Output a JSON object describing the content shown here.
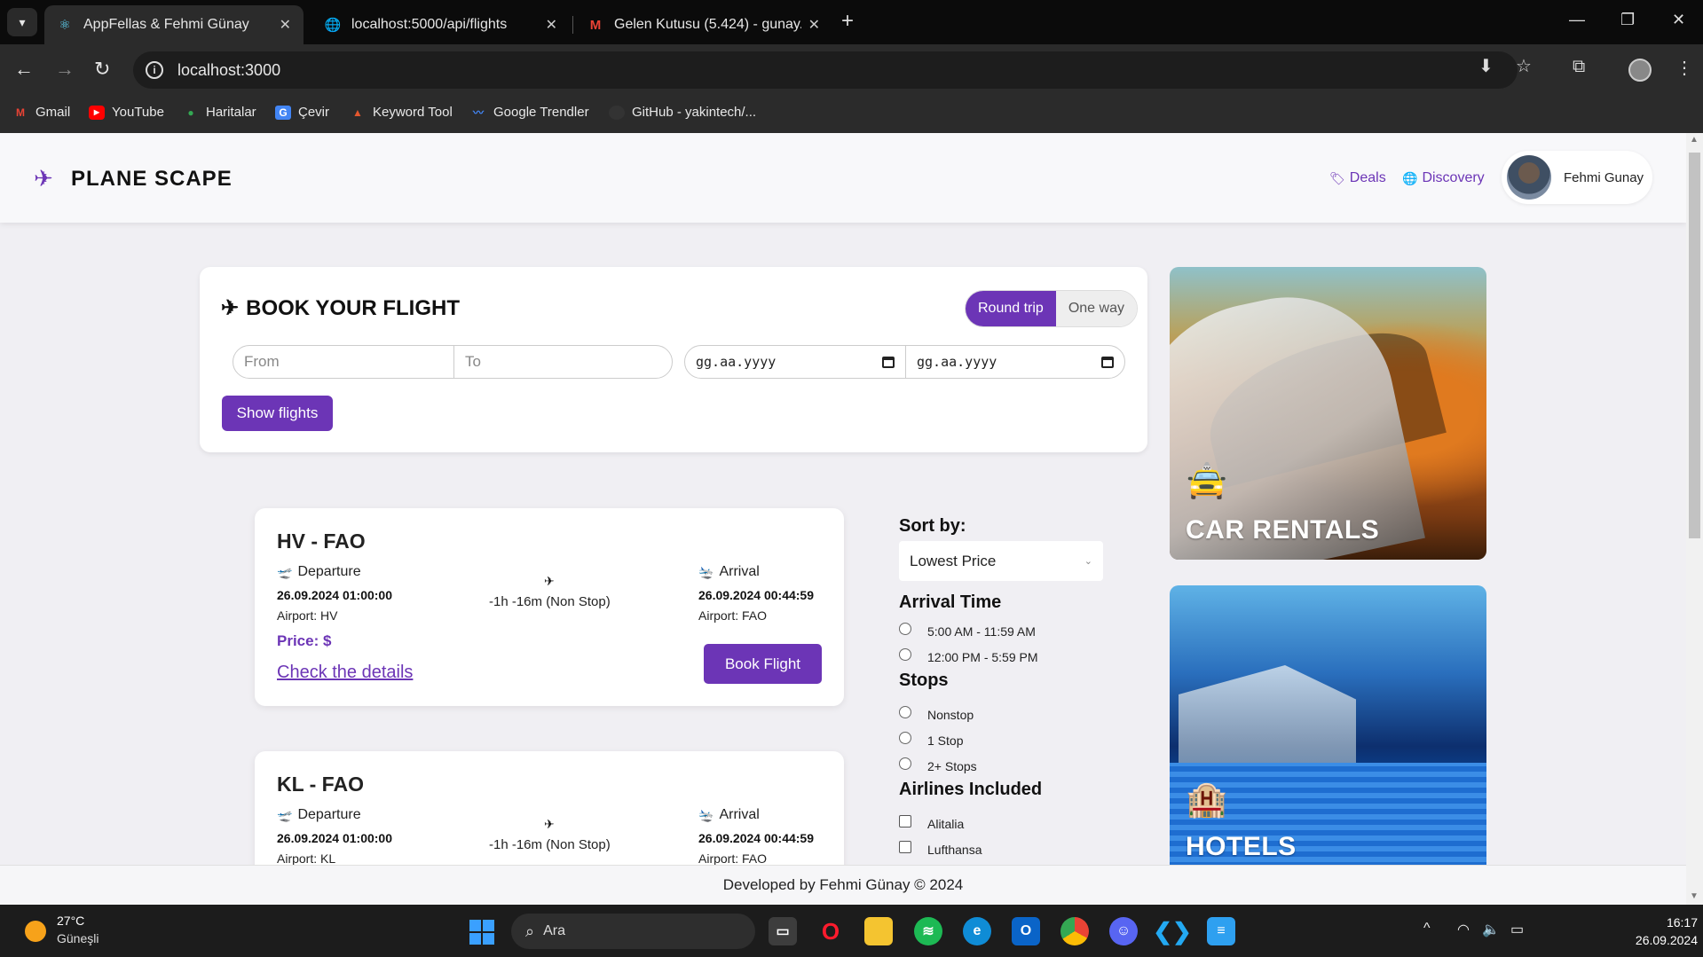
{
  "browser": {
    "tabs": [
      {
        "title": "AppFellas & Fehmi Günay",
        "icon": "react-icon",
        "active": true
      },
      {
        "title": "localhost:5000/api/flights",
        "icon": "globe-icon",
        "active": false
      },
      {
        "title": "Gelen Kutusu (5.424) - gunay.fe",
        "icon": "gmail-icon",
        "active": false
      }
    ],
    "url": "localhost:3000",
    "bookmarks": [
      {
        "label": "Gmail",
        "icon": "gmail-icon"
      },
      {
        "label": "YouTube",
        "icon": "youtube-icon"
      },
      {
        "label": "Haritalar",
        "icon": "maps-icon"
      },
      {
        "label": "Çevir",
        "icon": "translate-icon"
      },
      {
        "label": "Keyword Tool",
        "icon": "keyword-icon"
      },
      {
        "label": "Google Trendler",
        "icon": "trends-icon"
      },
      {
        "label": "GitHub - yakintech/...",
        "icon": "github-icon"
      }
    ]
  },
  "header": {
    "logo_text": "PLANE SCAPE",
    "nav": [
      {
        "label": "Deals",
        "icon": "tag-icon"
      },
      {
        "label": "Discovery",
        "icon": "globe-icon"
      }
    ],
    "user_name": "Fehmi Gunay"
  },
  "booking": {
    "title": "BOOK YOUR FLIGHT",
    "trip_options": [
      "Round trip",
      "One way"
    ],
    "selected_trip": "Round trip",
    "from_placeholder": "From",
    "to_placeholder": "To",
    "date_placeholder": "gg.aa.yyyy",
    "return_placeholder": "gg.aa.yyyy",
    "submit_label": "Show flights"
  },
  "flights": [
    {
      "route": "HV - FAO",
      "departure_label": "Departure",
      "departure_time": "26.09.2024 01:00:00",
      "departure_airport": "Airport: HV",
      "duration": "-1h -16m (Non Stop)",
      "arrival_label": "Arrival",
      "arrival_time": "26.09.2024 00:44:59",
      "arrival_airport": "Airport: FAO",
      "price": "Price: $",
      "details_label": "Check the details",
      "book_label": "Book Flight"
    },
    {
      "route": "KL - FAO",
      "departure_label": "Departure",
      "departure_time": "26.09.2024 01:00:00",
      "departure_airport": "Airport: KL",
      "duration": "-1h -16m (Non Stop)",
      "arrival_label": "Arrival",
      "arrival_time": "26.09.2024 00:44:59",
      "arrival_airport": "Airport: FAO"
    }
  ],
  "filters": {
    "sort_heading": "Sort by:",
    "sort_value": "Lowest Price",
    "arrival_heading": "Arrival Time",
    "arrival_options": [
      "5:00 AM - 11:59 AM",
      "12:00 PM - 5:59 PM"
    ],
    "stops_heading": "Stops",
    "stops_options": [
      "Nonstop",
      "1 Stop",
      "2+ Stops"
    ],
    "airlines_heading": "Airlines Included",
    "airlines_options": [
      "Alitalia",
      "Lufthansa"
    ]
  },
  "promos": [
    {
      "label": "CAR RENTALS",
      "icon": "car-icon"
    },
    {
      "label": "HOTELS",
      "icon": "hotel-icon"
    }
  ],
  "footer": {
    "text": "Developed by Fehmi Günay © 2024"
  },
  "taskbar": {
    "temperature": "27°C",
    "weather": "Güneşli",
    "search_placeholder": "Ara",
    "time": "16:17",
    "date": "26.09.2024"
  },
  "colors": {
    "accent": "#6c35b6",
    "background": "#f0eff3"
  }
}
